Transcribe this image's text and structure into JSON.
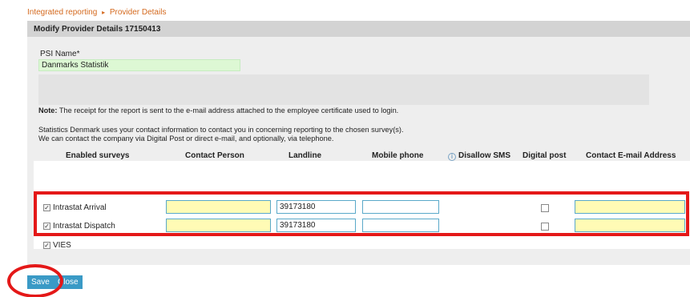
{
  "breadcrumb": {
    "parent": "Integrated reporting",
    "separator": "▸",
    "current": "Provider Details"
  },
  "panel": {
    "title": "Modify Provider Details 17150413"
  },
  "psi": {
    "label": "PSI Name*",
    "value": "Danmarks Statistik"
  },
  "note": {
    "bold": "Note:",
    "text": " The receipt for the report is sent to the e-mail address attached to the employee certificate used to login."
  },
  "statement": {
    "line1": "Statistics Denmark uses your contact information to contact you in concerning reporting to the chosen survey(s).",
    "line2": "We can contact the company via Digital Post or direct e-mail, and optionally, via telephone."
  },
  "table": {
    "headers": {
      "enabled_surveys": "Enabled surveys",
      "contact_person": "Contact Person",
      "landline": "Landline",
      "mobile_phone": "Mobile phone",
      "disallow_sms": "Disallow SMS",
      "digital_post": "Digital post",
      "contact_email": "Contact E-mail Address"
    },
    "rows": [
      {
        "label": "Intrastat Arrival",
        "checked": true,
        "contact_person": "",
        "landline": "39173180",
        "mobile": "",
        "digital_post": false,
        "email": ""
      },
      {
        "label": "Intrastat Dispatch",
        "checked": true,
        "contact_person": "",
        "landline": "39173180",
        "mobile": "",
        "digital_post": false,
        "email": ""
      },
      {
        "label": "VIES",
        "checked": true
      }
    ]
  },
  "buttons": {
    "save": "Save",
    "close": "Close"
  },
  "colors": {
    "accent": "#3a9ac6",
    "highlight_red": "#e41818",
    "breadcrumb": "#d4691e",
    "psi_bg": "#ddf8d4",
    "input_yellow": "#fffbb5"
  }
}
